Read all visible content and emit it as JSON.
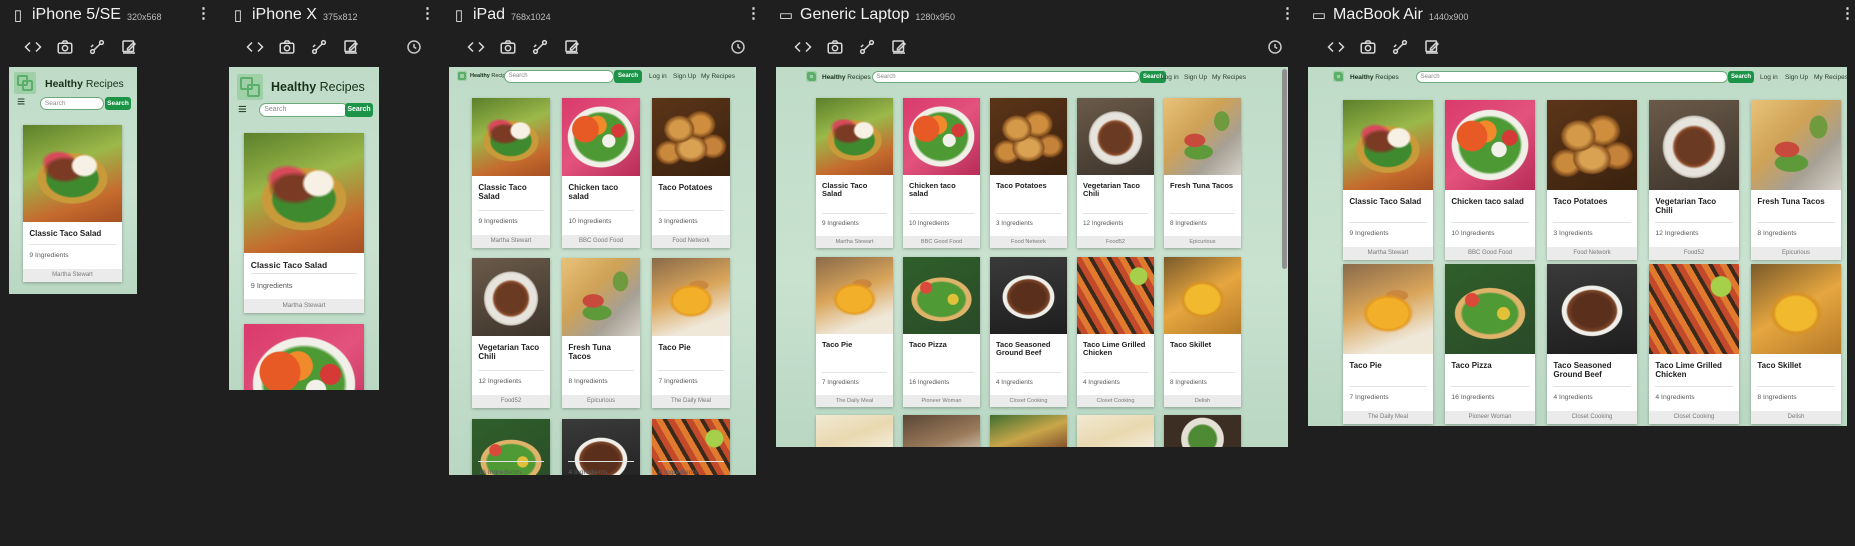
{
  "devices": [
    {
      "name": "iPhone 5/SE",
      "size": "320x568",
      "icon": "phone-icon"
    },
    {
      "name": "iPhone X",
      "size": "375x812",
      "icon": "phone-icon"
    },
    {
      "name": "iPad",
      "size": "768x1024",
      "icon": "tablet-icon"
    },
    {
      "name": "Generic Laptop",
      "size": "1280x950",
      "icon": "monitor-icon"
    },
    {
      "name": "MacBook Air",
      "size": "1440x900",
      "icon": "monitor-icon"
    }
  ],
  "site": {
    "brand_bold": "Healthy",
    "brand_rest": " Recipes",
    "search_placeholder": "Search",
    "search_button": "Search",
    "nav": {
      "login": "Log in",
      "signup": "Sign Up",
      "myrecipes": "My Recipes"
    }
  },
  "recipes": [
    {
      "title": "Classic Taco Salad",
      "ingredients": "9 Ingredients",
      "source": "Martha Stewart",
      "img": "salad"
    },
    {
      "title": "Chicken taco salad",
      "ingredients": "10 Ingredients",
      "source": "BBC Good Food",
      "img": "chicken"
    },
    {
      "title": "Taco Potatoes",
      "ingredients": "3 Ingredients",
      "source": "Food Network",
      "img": "potatoes"
    },
    {
      "title": "Vegetarian Taco Chili",
      "ingredients": "12 Ingredients",
      "source": "Food52",
      "img": "chili"
    },
    {
      "title": "Fresh Tuna Tacos",
      "ingredients": "8 Ingredients",
      "source": "Epicurious",
      "img": "tuna"
    },
    {
      "title": "Taco Pie",
      "ingredients": "7 Ingredients",
      "source": "The Daily Meal",
      "img": "pie"
    },
    {
      "title": "Taco Pizza",
      "ingredients": "16 Ingredients",
      "source": "Pioneer Woman",
      "img": "pizza"
    },
    {
      "title": "Taco Seasoned Ground Beef",
      "ingredients": "4 Ingredients",
      "source": "Closet Cooking",
      "img": "beef"
    },
    {
      "title": "Taco Lime Grilled Chicken",
      "ingredients": "4 Ingredients",
      "source": "Closet Cooking",
      "img": "lime"
    },
    {
      "title": "Taco Skillet",
      "ingredients": "8 Ingredients",
      "source": "Delish",
      "img": "skillet"
    }
  ],
  "colors": {
    "app_bg": "#1f1f1f",
    "page_bg": "#c2ddc9",
    "accent_green": "#1b9448",
    "card_footer": "#ebebeb"
  }
}
